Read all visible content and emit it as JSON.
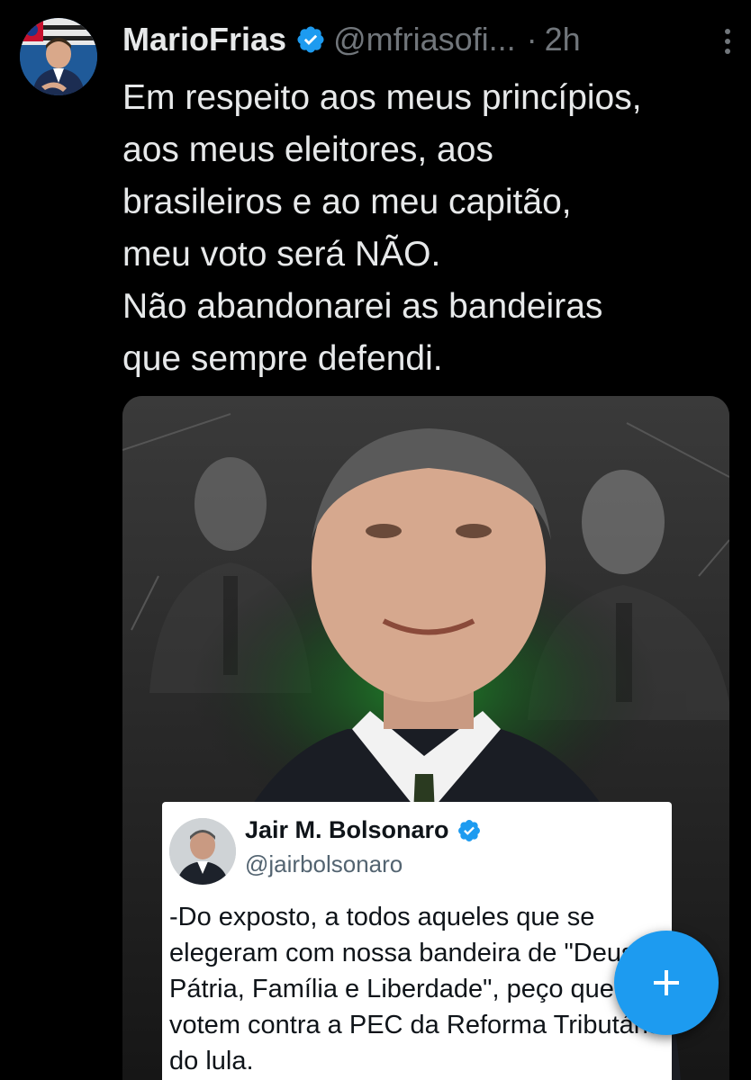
{
  "tweet": {
    "author_name": "MarioFrias",
    "handle": "@mfriasofi...",
    "separator": "·",
    "time": "2h",
    "text_lines": [
      "Em respeito aos meus princípios,",
      "aos meus eleitores, aos",
      "brasileiros e ao meu capitão,",
      "meu voto será NÃO.",
      "Não abandonarei as bandeiras",
      "que sempre defendi."
    ]
  },
  "quoted": {
    "name": "Jair M. Bolsonaro",
    "handle": "@jairbolsonaro",
    "text_lines": [
      "-Do exposto, a todos aqueles que se",
      "elegeram com nossa bandeira de \"Deus,",
      "Pátria, Família e Liberdade\", peço que",
      "votem contra a PEC da Reforma Tributária",
      "do lula."
    ]
  },
  "icons": {
    "verified": "verified-badge-icon",
    "more": "more-options-icon",
    "compose": "plus-icon"
  },
  "colors": {
    "background": "#000000",
    "text": "#e7e9ea",
    "muted": "#71767b",
    "accent": "#1d9bf0"
  }
}
